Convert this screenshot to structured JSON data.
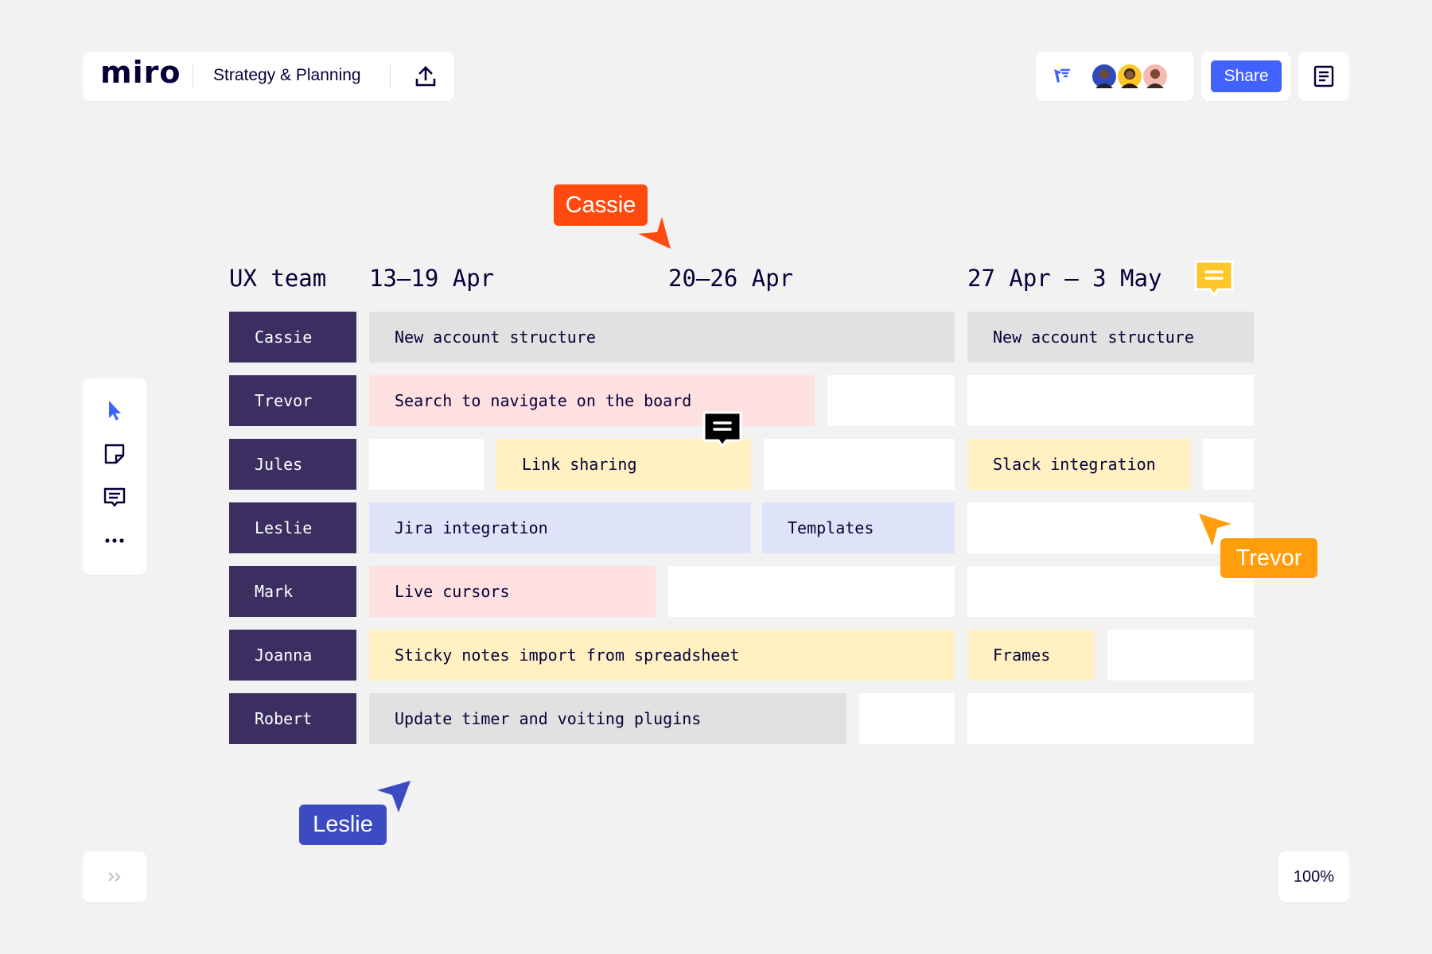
{
  "app": {
    "logo": "miro",
    "board_title": "Strategy & Planning"
  },
  "toolbar": {
    "share_label": "Share"
  },
  "zoom": {
    "level": "100%"
  },
  "board": {
    "team_label": "UX team",
    "weeks": [
      "13–19 Apr",
      "20–26 Apr",
      "27 Apr – 3 May"
    ],
    "rows": [
      {
        "name": "Cassie",
        "tasks": [
          "New account structure",
          "New account structure"
        ]
      },
      {
        "name": "Trevor",
        "tasks": [
          "Search to navigate on the board"
        ]
      },
      {
        "name": "Jules",
        "tasks": [
          "Link sharing",
          "Slack integration"
        ]
      },
      {
        "name": "Leslie",
        "tasks": [
          "Jira integration",
          "Templates"
        ]
      },
      {
        "name": "Mark",
        "tasks": [
          "Live cursors"
        ]
      },
      {
        "name": "Joanna",
        "tasks": [
          "Sticky notes import from spreadsheet",
          "Frames"
        ]
      },
      {
        "name": "Robert",
        "tasks": [
          "Update timer and voiting plugins"
        ]
      }
    ]
  },
  "cursors": [
    {
      "name": "Cassie",
      "color": "#ff4a0f"
    },
    {
      "name": "Trevor",
      "color": "#ff9d0c"
    },
    {
      "name": "Leslie",
      "color": "#3c4bc2"
    }
  ],
  "colors": {
    "brand": "#050038",
    "accent": "#4262ff",
    "name_cell": "#3a2f60",
    "comment_yellow": "#ffc629"
  },
  "icons": [
    "upload-icon",
    "attention-flag-icon",
    "notes-icon",
    "select-icon",
    "sticky-note-icon",
    "comment-icon",
    "more-icon",
    "expand-icon"
  ]
}
